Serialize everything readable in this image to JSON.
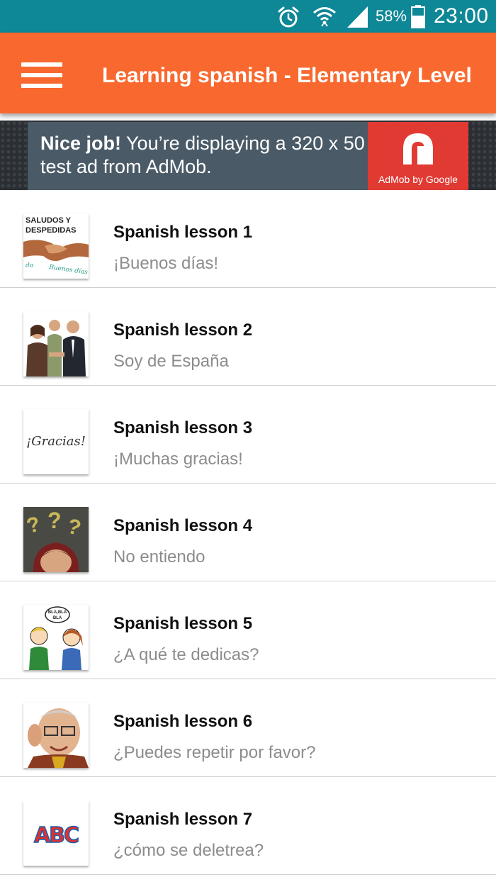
{
  "status_bar": {
    "battery_percent": "58%",
    "time": "23:00",
    "icons": [
      "alarm-icon",
      "wifi-icon",
      "signal-icon",
      "battery-icon"
    ]
  },
  "app_bar": {
    "title": "Learning spanish - Elementary Level",
    "menu_icon": "hamburger-menu-icon",
    "background_color": "#f9692f"
  },
  "ad": {
    "headline": "Nice job!",
    "text": " You’re displaying a 320 x 50 test ad from AdMob.",
    "brand_label": "AdMob by Google",
    "background_color": "#4a5a67",
    "logo_color": "#e13a33"
  },
  "lessons": [
    {
      "title": "Spanish lesson 1",
      "subtitle": "¡Buenos días!",
      "thumb_text_1": "SALUDOS Y",
      "thumb_text_2": "DESPEDIDAS",
      "thumb_text_3": "Buenos días",
      "thumb_text_4": "do"
    },
    {
      "title": "Spanish lesson 2",
      "subtitle": "Soy de España"
    },
    {
      "title": "Spanish lesson 3",
      "subtitle": "¡Muchas gracias!",
      "thumb_text": "¡Gracias!"
    },
    {
      "title": "Spanish lesson 4",
      "subtitle": "No entiendo"
    },
    {
      "title": "Spanish lesson 5",
      "subtitle": "¿A qué te dedicas?",
      "thumb_text_1": "BLA,BLA",
      "thumb_text_2": "BLA"
    },
    {
      "title": "Spanish lesson 6",
      "subtitle": "¿Puedes repetir por favor?"
    },
    {
      "title": "Spanish lesson 7",
      "subtitle": "¿cómo se deletrea?",
      "thumb_text": "ABC"
    }
  ]
}
